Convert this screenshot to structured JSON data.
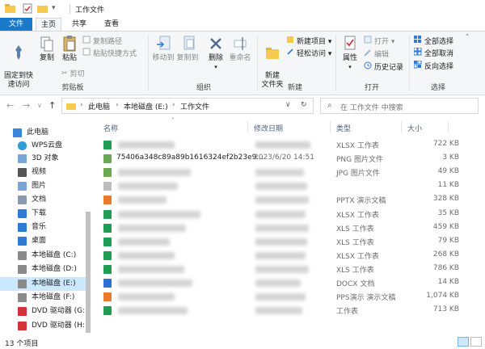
{
  "window": {
    "title": "工作文件"
  },
  "ribbon": {
    "tabs": [
      "文件",
      "主页",
      "共享",
      "查看"
    ],
    "clipboard": {
      "pin": "固定到快\n速访问",
      "copy": "复制",
      "paste": "粘贴",
      "copy_path": "复制路径",
      "paste_shortcut": "粘贴快捷方式",
      "cut": "剪切",
      "label": "剪贴板"
    },
    "organize": {
      "move_to": "移动到",
      "copy_to": "复制到",
      "delete": "删除",
      "rename": "重命名",
      "label": "组织"
    },
    "new": {
      "new_folder": "新建\n文件夹",
      "new_item": "新建项目",
      "easy_access": "轻松访问",
      "label": "新建"
    },
    "open": {
      "properties": "属性",
      "open": "打开",
      "edit": "编辑",
      "history": "历史记录",
      "label": "打开"
    },
    "select": {
      "select_all": "全部选择",
      "select_none": "全部取消",
      "invert": "反向选择",
      "label": "选择"
    }
  },
  "address": {
    "crumbs": [
      "此电脑",
      "本地磁盘 (E:)",
      "工作文件"
    ],
    "search_placeholder": "在 工作文件 中搜索"
  },
  "nav": {
    "items": [
      {
        "label": "此电脑",
        "icon": "computer-icon",
        "selected": false
      },
      {
        "label": "WPS云盘",
        "icon": "cloud-icon",
        "selected": false
      },
      {
        "label": "3D 对象",
        "icon": "cube-icon",
        "selected": false
      },
      {
        "label": "视频",
        "icon": "video-icon",
        "selected": false
      },
      {
        "label": "图片",
        "icon": "picture-icon",
        "selected": false
      },
      {
        "label": "文档",
        "icon": "document-icon",
        "selected": false
      },
      {
        "label": "下载",
        "icon": "download-icon",
        "selected": false
      },
      {
        "label": "音乐",
        "icon": "music-icon",
        "selected": false
      },
      {
        "label": "桌面",
        "icon": "desktop-icon",
        "selected": false
      },
      {
        "label": "本地磁盘 (C:)",
        "icon": "drive-icon",
        "selected": false
      },
      {
        "label": "本地磁盘 (D:)",
        "icon": "drive-icon",
        "selected": false
      },
      {
        "label": "本地磁盘 (E:)",
        "icon": "drive-icon",
        "selected": true
      },
      {
        "label": "本地磁盘 (F:)",
        "icon": "drive-icon",
        "selected": false
      },
      {
        "label": "DVD 驱动器 (G:",
        "icon": "dvd-icon",
        "selected": false
      },
      {
        "label": "DVD 驱动器 (H:",
        "icon": "dvd-icon",
        "selected": false
      }
    ]
  },
  "list": {
    "columns": {
      "name": "名称",
      "date": "修改日期",
      "type": "类型",
      "size": "大小"
    },
    "rows": [
      {
        "name": "",
        "date": "",
        "type": "XLSX 工作表",
        "size": "722 KB",
        "icon_color": "#1f9d55"
      },
      {
        "name": "75406a348c89a89b1616324ef2b23e9...",
        "date": "2023/6/20 14:51",
        "type": "PNG 图片文件",
        "size": "3 KB",
        "icon_color": "#6aa84f"
      },
      {
        "name": "",
        "date": "",
        "type": "JPG 图片文件",
        "size": "49 KB",
        "icon_color": "#6aa84f"
      },
      {
        "name": "",
        "date": "",
        "type": "",
        "size": "11 KB",
        "icon_color": "#bdbdbd"
      },
      {
        "name": "",
        "date": "",
        "type": "PPTX 演示文稿",
        "size": "328 KB",
        "icon_color": "#e8792d"
      },
      {
        "name": "",
        "date": "",
        "type": "XLSX 工作表",
        "size": "35 KB",
        "icon_color": "#1f9d55"
      },
      {
        "name": "",
        "date": "",
        "type": "XLS 工作表",
        "size": "459 KB",
        "icon_color": "#1f9d55"
      },
      {
        "name": "",
        "date": "",
        "type": "XLS 工作表",
        "size": "79 KB",
        "icon_color": "#1f9d55"
      },
      {
        "name": "",
        "date": "",
        "type": "XLSX 工作表",
        "size": "268 KB",
        "icon_color": "#1f9d55"
      },
      {
        "name": "",
        "date": "",
        "type": "XLS 工作表",
        "size": "786 KB",
        "icon_color": "#1f9d55"
      },
      {
        "name": "",
        "date": "",
        "type": "DOCX 文档",
        "size": "14 KB",
        "icon_color": "#2f6fd6"
      },
      {
        "name": "",
        "date": "",
        "type": "PPS演示 演示文稿",
        "size": "1,074 KB",
        "icon_color": "#e8792d"
      },
      {
        "name": "",
        "date": "",
        "type": "工作表",
        "size": "713 KB",
        "icon_color": "#1f9d55"
      }
    ]
  },
  "status": {
    "count": "13 个项目"
  }
}
